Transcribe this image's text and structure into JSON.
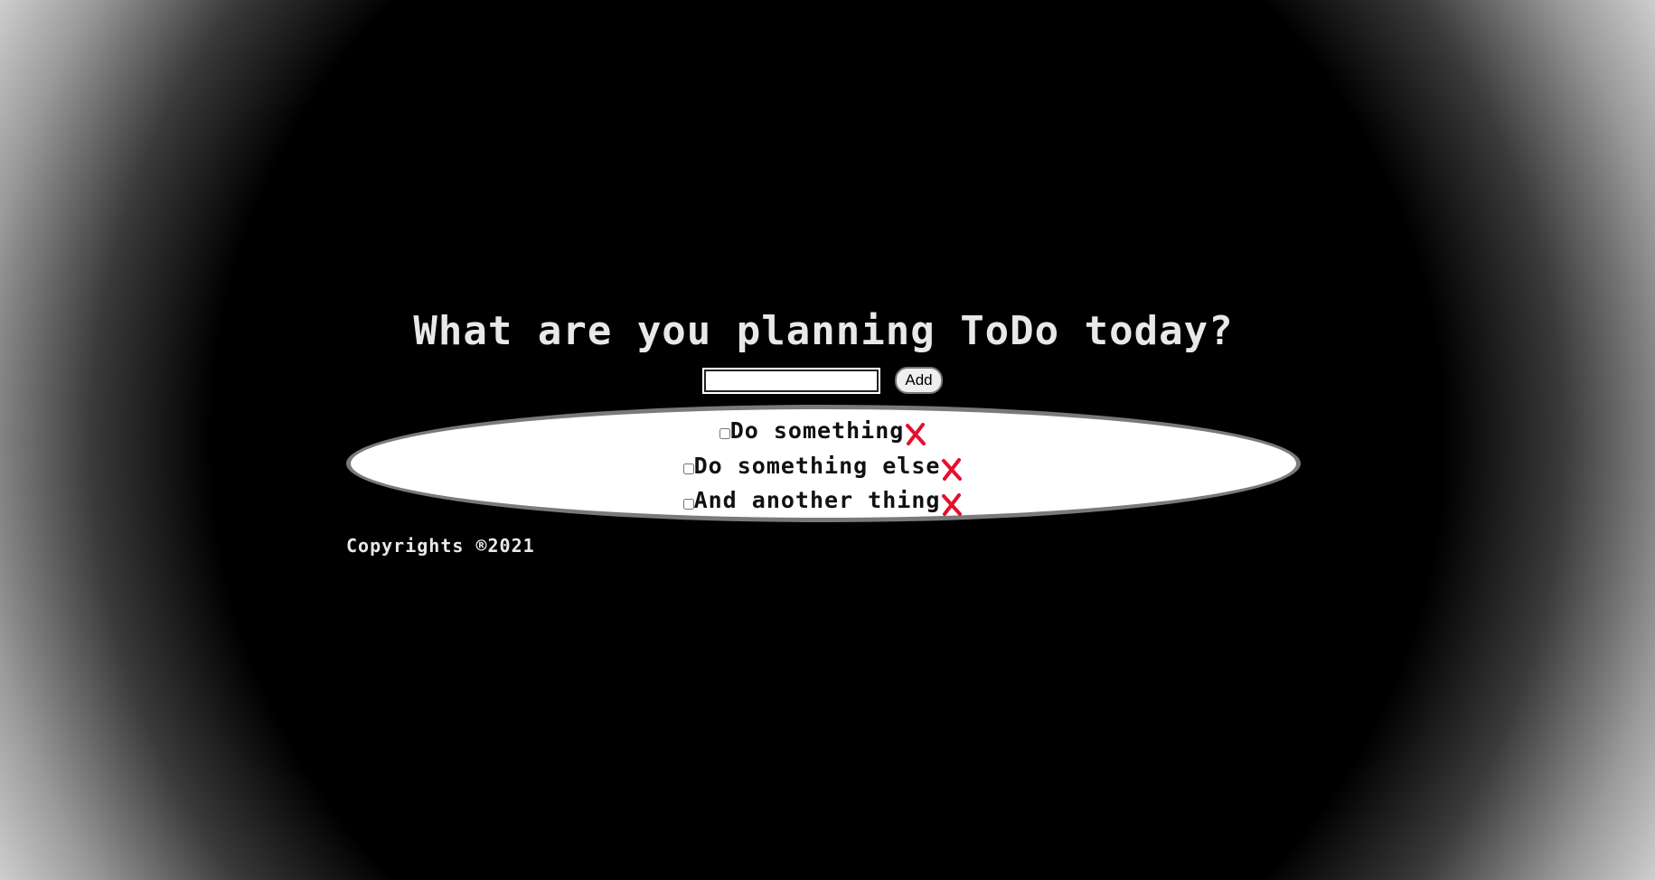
{
  "header": {
    "title": "What are you planning ToDo today?"
  },
  "form": {
    "input_value": "",
    "input_placeholder": "",
    "add_label": "Add"
  },
  "todos": [
    {
      "label": "Do something",
      "checked": false,
      "delete_icon": "red-x-icon"
    },
    {
      "label": "Do something else",
      "checked": false,
      "delete_icon": "red-x-icon"
    },
    {
      "label": "And another thing",
      "checked": false,
      "delete_icon": "red-x-icon"
    }
  ],
  "footer": {
    "copyright": "Copyrights ®2021"
  },
  "colors": {
    "delete_icon": "#e5102c",
    "panel_border": "#7a7a7a",
    "title_text": "#e8e8e8"
  }
}
